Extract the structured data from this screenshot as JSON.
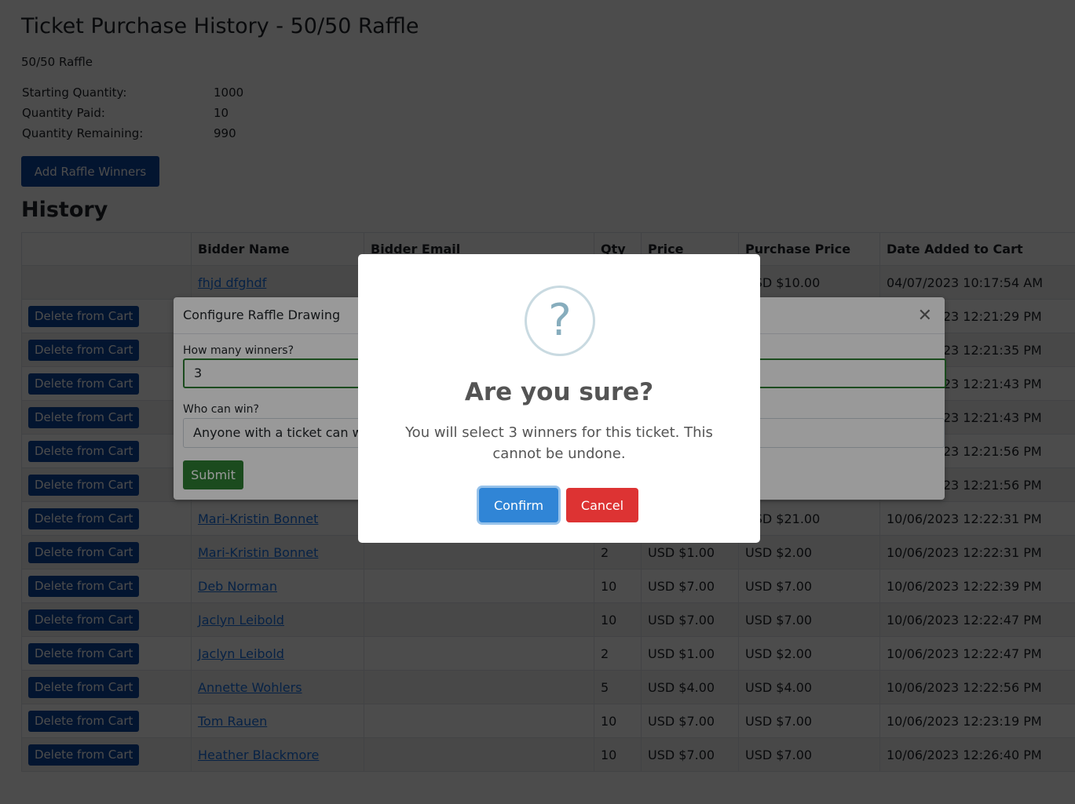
{
  "page": {
    "title": "Ticket Purchase History - 50/50 Raffle",
    "subtitle": "50/50 Raffle",
    "stats": [
      {
        "label": "Starting Quantity:",
        "value": "1000"
      },
      {
        "label": "Quantity Paid:",
        "value": "10"
      },
      {
        "label": "Quantity Remaining:",
        "value": "990"
      }
    ],
    "add_winners_label": "Add Raffle Winners",
    "history_title": "History"
  },
  "table": {
    "headers": [
      "",
      "Bidder Name",
      "Bidder Email",
      "Qty",
      "Price",
      "Purchase Price",
      "Date Added to Cart"
    ],
    "delete_label": "Delete from Cart",
    "rows": [
      {
        "action": "",
        "name": "fhjd dfghdf",
        "email": "",
        "qty": "",
        "price": "",
        "purchase": "USD $10.00",
        "date": "04/07/2023 10:17:54 AM"
      },
      {
        "action": "Delete from Cart",
        "name": "",
        "email": "",
        "qty": "",
        "price": "",
        "purchase": "",
        "date": "10/06/2023 12:21:29 PM"
      },
      {
        "action": "Delete from Cart",
        "name": "",
        "email": "",
        "qty": "",
        "price": "",
        "purchase": "",
        "date": "10/06/2023 12:21:35 PM"
      },
      {
        "action": "Delete from Cart",
        "name": "",
        "email": "",
        "qty": "",
        "price": "",
        "purchase": "",
        "date": "10/06/2023 12:21:43 PM"
      },
      {
        "action": "Delete from Cart",
        "name": "",
        "email": "",
        "qty": "",
        "price": "",
        "purchase": "",
        "date": "10/06/2023 12:21:43 PM"
      },
      {
        "action": "Delete from Cart",
        "name": "",
        "email": "",
        "qty": "",
        "price": "",
        "purchase": "",
        "date": "10/06/2023 12:21:56 PM"
      },
      {
        "action": "Delete from Cart",
        "name": "",
        "email": "",
        "qty": "",
        "price": "",
        "purchase": "",
        "date": "10/06/2023 12:21:56 PM"
      },
      {
        "action": "Delete from Cart",
        "name": "Mari-Kristin Bonnet",
        "email": "",
        "qty": "",
        "price": "",
        "purchase": "USD $21.00",
        "date": "10/06/2023 12:22:31 PM"
      },
      {
        "action": "Delete from Cart",
        "name": "Mari-Kristin Bonnet",
        "email": "",
        "qty": "2",
        "price": "USD $1.00",
        "purchase": "USD $2.00",
        "date": "10/06/2023 12:22:31 PM"
      },
      {
        "action": "Delete from Cart",
        "name": "Deb Norman",
        "email": "",
        "qty": "10",
        "price": "USD $7.00",
        "purchase": "USD $7.00",
        "date": "10/06/2023 12:22:39 PM"
      },
      {
        "action": "Delete from Cart",
        "name": "Jaclyn Leibold",
        "email": "",
        "qty": "10",
        "price": "USD $7.00",
        "purchase": "USD $7.00",
        "date": "10/06/2023 12:22:47 PM"
      },
      {
        "action": "Delete from Cart",
        "name": "Jaclyn Leibold",
        "email": "",
        "qty": "2",
        "price": "USD $1.00",
        "purchase": "USD $2.00",
        "date": "10/06/2023 12:22:47 PM"
      },
      {
        "action": "Delete from Cart",
        "name": "Annette Wohlers",
        "email": "",
        "qty": "5",
        "price": "USD $4.00",
        "purchase": "USD $4.00",
        "date": "10/06/2023 12:22:56 PM"
      },
      {
        "action": "Delete from Cart",
        "name": "Tom Rauen",
        "email": "",
        "qty": "10",
        "price": "USD $7.00",
        "purchase": "USD $7.00",
        "date": "10/06/2023 12:23:19 PM"
      },
      {
        "action": "Delete from Cart",
        "name": "Heather Blackmore",
        "email": "",
        "qty": "10",
        "price": "USD $7.00",
        "purchase": "USD $7.00",
        "date": "10/06/2023 12:26:40 PM"
      }
    ]
  },
  "config_modal": {
    "title": "Configure Raffle Drawing",
    "winners_label": "How many winners?",
    "winners_value": "3",
    "who_label": "Who can win?",
    "who_value": "Anyone with a ticket can win.",
    "submit_label": "Submit",
    "close_icon": "close-icon"
  },
  "alert": {
    "icon": "?",
    "title": "Are you sure?",
    "text": "You will select 3 winners for this ticket. This cannot be undone.",
    "confirm_label": "Confirm",
    "cancel_label": "Cancel"
  },
  "colors": {
    "primary_dark": "#0d47a1",
    "link": "#1a73e8",
    "success": "#2e7d32",
    "confirm": "#3085d6",
    "cancel": "#dd3333"
  }
}
